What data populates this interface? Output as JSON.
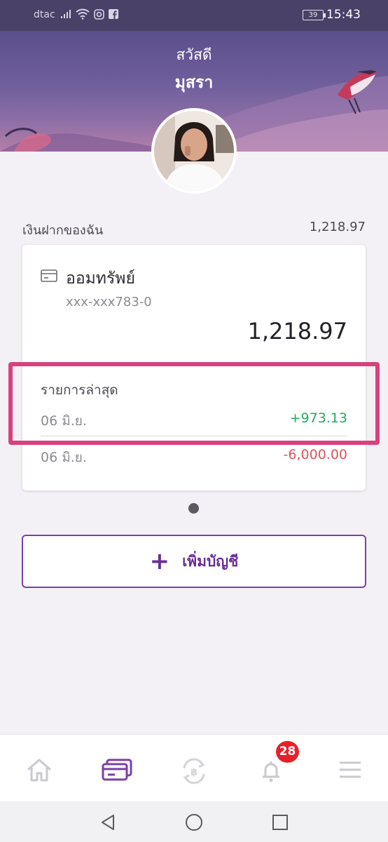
{
  "status_bar": {
    "carrier": "dtac",
    "battery": "39",
    "time": "15:43",
    "icons": [
      "signal-icon",
      "wifi-icon",
      "instagram-icon",
      "facebook-icon"
    ]
  },
  "header": {
    "greeting": "สวัสดี",
    "username": "มุสรา"
  },
  "deposits": {
    "label": "เงินฝากของฉัน",
    "total": "1,218.97"
  },
  "account": {
    "icon": "account-card-icon",
    "name": "ออมทรัพย์",
    "number": "xxx-xxx783-0",
    "balance": "1,218.97",
    "recent_label": "รายการล่าสุด",
    "transactions": [
      {
        "date": "06 มิ.ย.",
        "amount": "+973.13",
        "type": "credit"
      },
      {
        "date": "06 มิ.ย.",
        "amount": "-6,000.00",
        "type": "debit"
      }
    ]
  },
  "add_account": {
    "plus": "+",
    "label": "เพิ่มบัญชี"
  },
  "bottom_nav": {
    "items": [
      "home-icon",
      "accounts-icon",
      "transfer-icon",
      "notifications-icon",
      "menu-icon"
    ],
    "active": "accounts-icon",
    "notification_count": "28"
  },
  "colors": {
    "accent": "#6a2f95",
    "positive": "#1fae5a",
    "negative": "#e0545a",
    "highlight": "#d8417e",
    "badge": "#e8202a"
  }
}
